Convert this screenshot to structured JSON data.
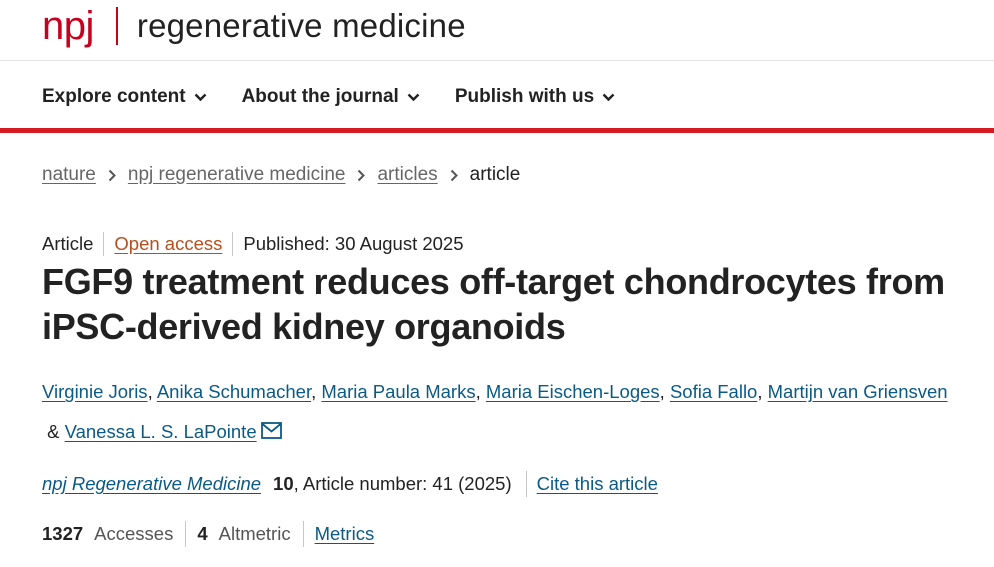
{
  "brand": {
    "logo_text": "npj",
    "journal_title": "regenerative medicine",
    "accent_color": "#c70020"
  },
  "nav": {
    "items": [
      {
        "label": "Explore content",
        "icon": "chevron-down-icon"
      },
      {
        "label": "About the journal",
        "icon": "chevron-down-icon"
      },
      {
        "label": "Publish with us",
        "icon": "chevron-down-icon"
      }
    ],
    "bar_color": "#d51a21"
  },
  "breadcrumb": {
    "items": [
      "nature",
      "npj regenerative medicine",
      "articles"
    ],
    "current": "article",
    "separator_icon": "chevron-right-icon"
  },
  "article": {
    "type": "Article",
    "access": "Open access",
    "published": "Published: 30 August 2025",
    "title": "FGF9 treatment reduces off-target chondrocytes from iPSC-derived kidney organoids",
    "authors": [
      "Virginie Joris",
      "Anika Schumacher",
      "Maria Paula Marks",
      "Maria Eischen-Loges",
      "Sofia Fallo",
      "Martijn van Griensven",
      "Vanessa L. S. LaPointe"
    ],
    "author_separator": ", ",
    "author_last_joiner": " & ",
    "contact_icon": "envelope-icon",
    "citation": {
      "journal": "npj Regenerative Medicine",
      "volume": "10",
      "article_number": ", Article number: 41 (2025)",
      "cite_label": "Cite this article"
    },
    "metrics": {
      "accesses_count": "1327",
      "accesses_label": "Accesses",
      "altmetric_count": "4",
      "altmetric_label": "Altmetric",
      "metrics_link": "Metrics"
    },
    "link_color": "#0a5a86",
    "open_access_color": "#b64e1f"
  }
}
